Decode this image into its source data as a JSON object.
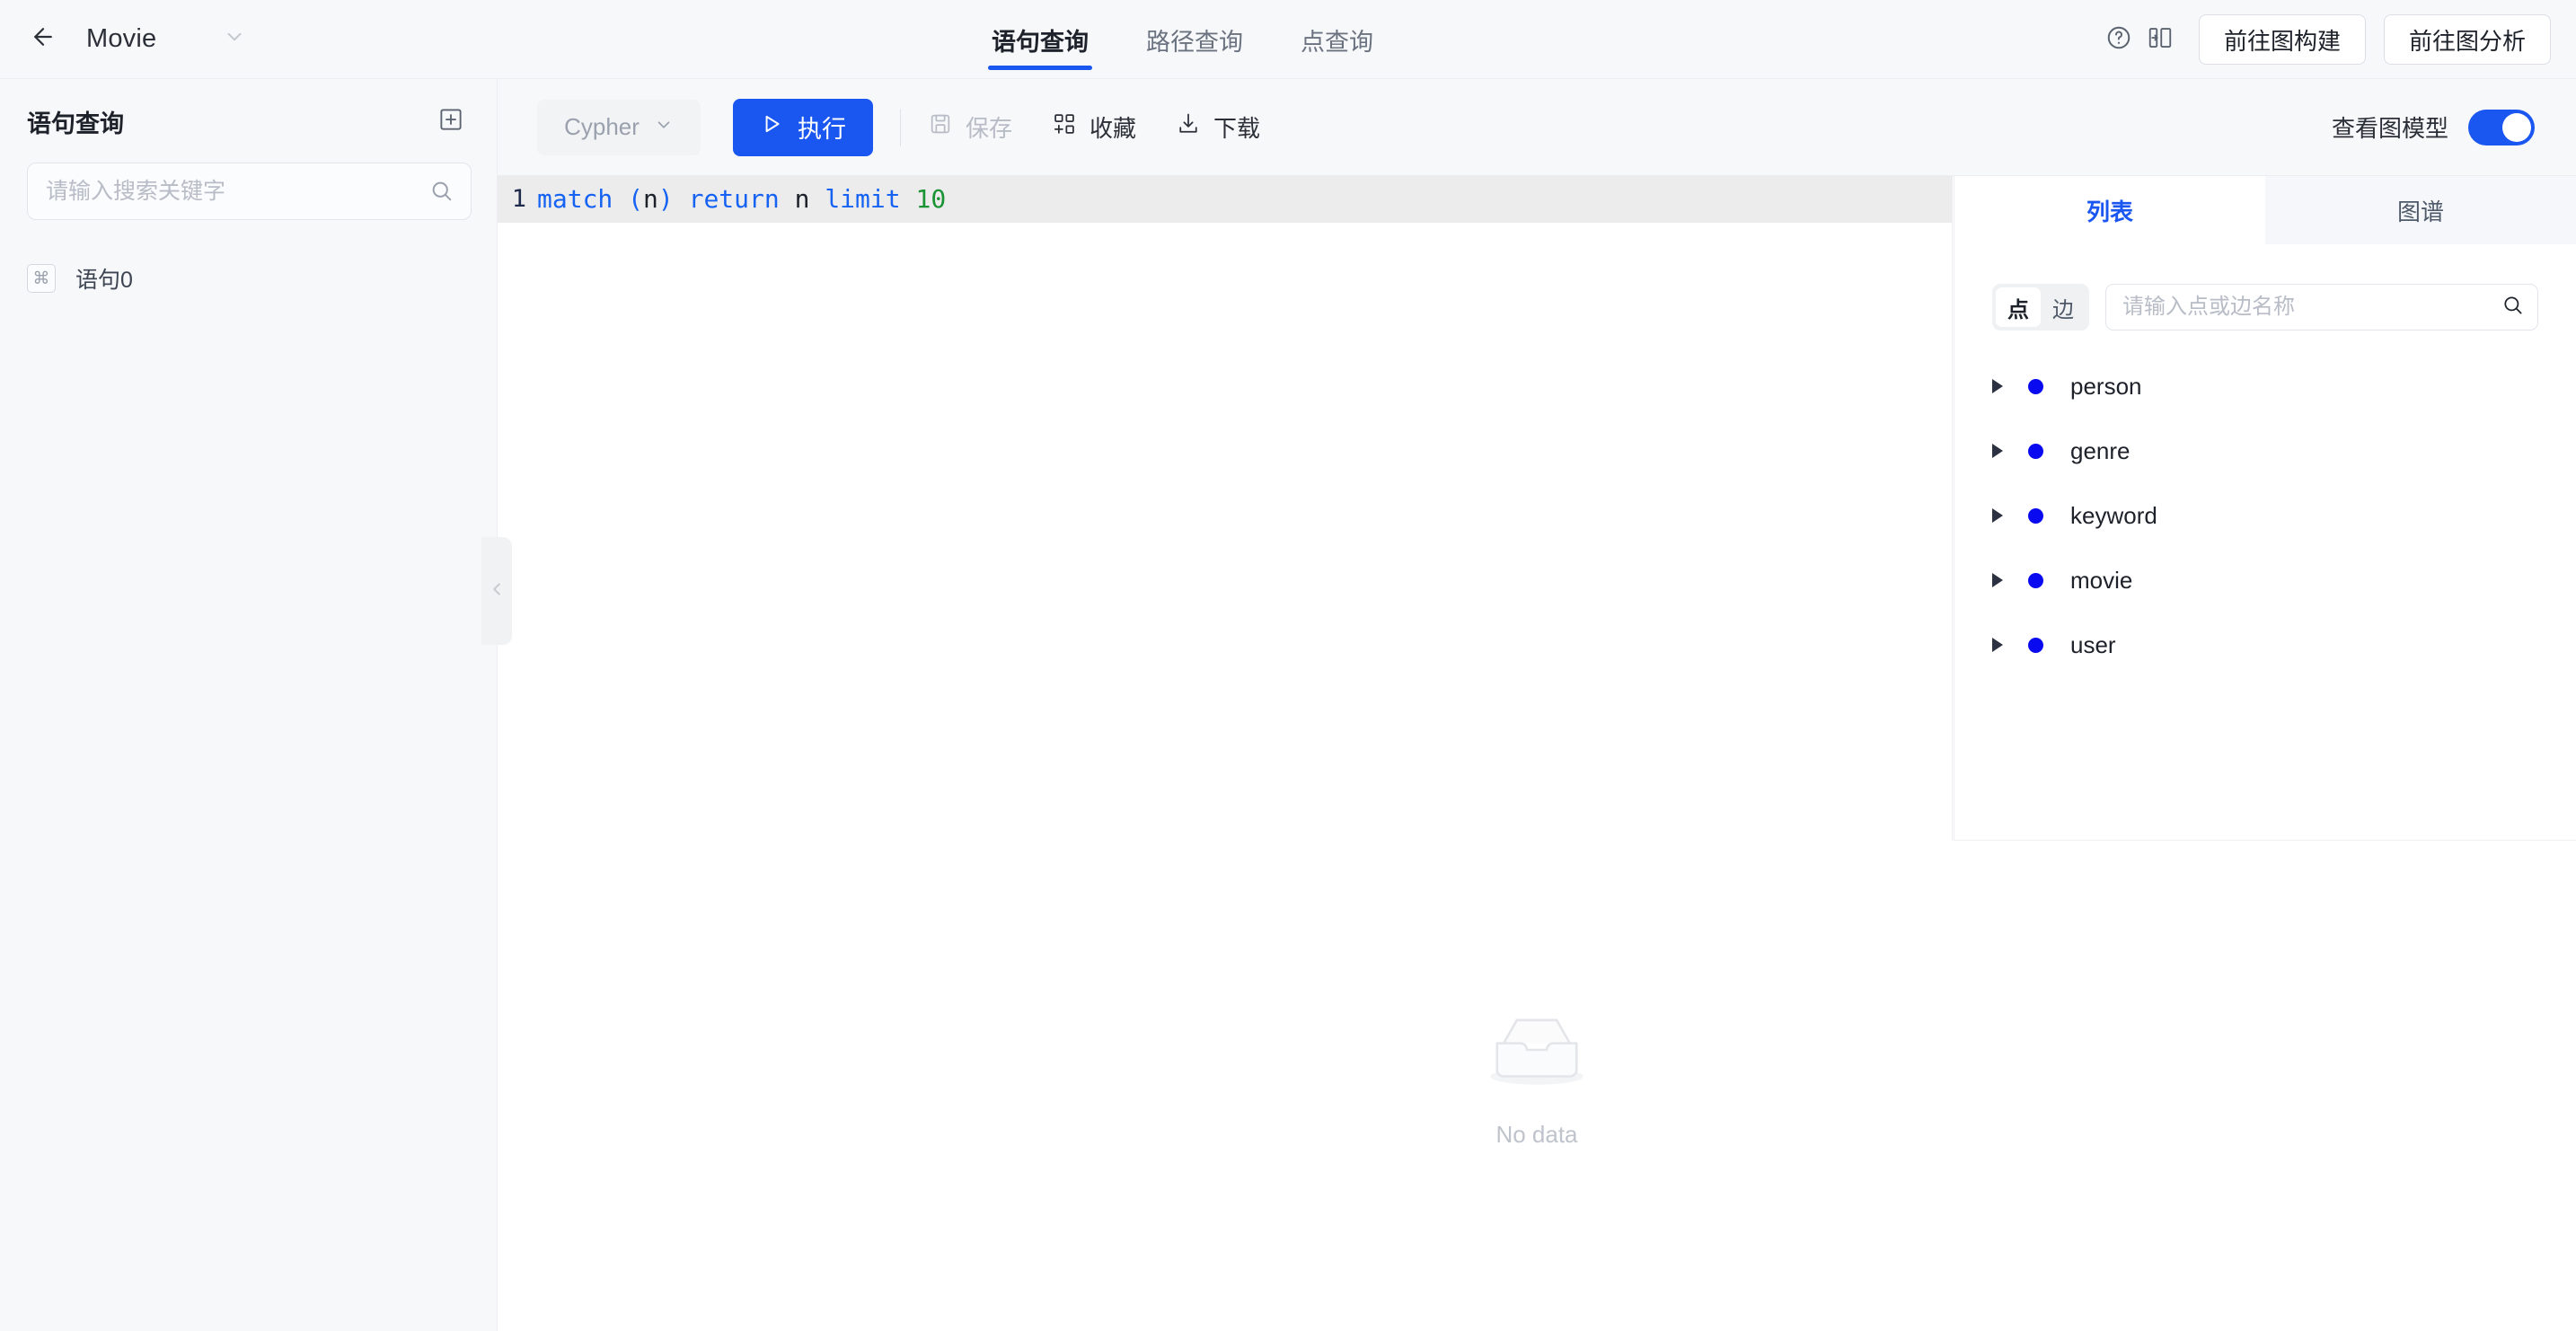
{
  "header": {
    "back_icon": "arrow-left-icon",
    "database_name": "Movie",
    "caret_icon": "chevron-down-icon",
    "tabs": [
      {
        "label": "语句查询",
        "active": true
      },
      {
        "label": "路径查询",
        "active": false
      },
      {
        "label": "点查询",
        "active": false
      }
    ],
    "help_icon": "question-circle-icon",
    "layout_icon": "panel-layout-icon",
    "buttons": [
      {
        "label": "前往图构建"
      },
      {
        "label": "前往图分析"
      }
    ]
  },
  "sidebar": {
    "title": "语句查询",
    "add_icon": "plus-square-icon",
    "search": {
      "placeholder": "请输入搜索关键字",
      "value": "",
      "icon": "search-icon"
    },
    "items": [
      {
        "label": "语句0",
        "icon": "command-icon"
      }
    ],
    "collapse_icon": "chevron-left-icon"
  },
  "toolbar": {
    "language": "Cypher",
    "language_caret_icon": "chevron-down-icon",
    "run_label": "执行",
    "run_icon": "play-icon",
    "save_label": "保存",
    "save_icon": "save-disk-icon",
    "favorite_label": "收藏",
    "favorite_icon": "add-collection-icon",
    "download_label": "下载",
    "download_icon": "download-icon",
    "view_model_label": "查看图模型",
    "view_model_on": true
  },
  "editor": {
    "line_number": "1",
    "tokens": [
      {
        "text": "match",
        "type": "keyword"
      },
      {
        "text": " ",
        "type": "space"
      },
      {
        "text": "(",
        "type": "keyword"
      },
      {
        "text": "n",
        "type": "plain"
      },
      {
        "text": ")",
        "type": "keyword"
      },
      {
        "text": " ",
        "type": "space"
      },
      {
        "text": "return",
        "type": "keyword"
      },
      {
        "text": " ",
        "type": "space"
      },
      {
        "text": "n",
        "type": "plain"
      },
      {
        "text": " ",
        "type": "space"
      },
      {
        "text": "limit",
        "type": "keyword"
      },
      {
        "text": " ",
        "type": "space"
      },
      {
        "text": "10",
        "type": "number"
      }
    ],
    "full_text": "match (n) return n limit 10"
  },
  "results": {
    "empty_icon": "empty-box-icon",
    "empty_text": "No data"
  },
  "right_panel": {
    "tabs": [
      {
        "label": "列表",
        "active": true
      },
      {
        "label": "图谱",
        "active": false
      }
    ],
    "segment": [
      {
        "label": "点",
        "selected": true
      },
      {
        "label": "边",
        "selected": false
      }
    ],
    "search": {
      "placeholder": "请输入点或边名称",
      "value": "",
      "icon": "search-icon"
    },
    "nodes": [
      {
        "label": "person"
      },
      {
        "label": "genre"
      },
      {
        "label": "keyword"
      },
      {
        "label": "movie"
      },
      {
        "label": "user"
      }
    ]
  },
  "colors": {
    "accent": "#1a56f0",
    "node_dot": "#0a0af0",
    "header_bg": "#f7f8fa",
    "code_keyword": "#1663f3",
    "code_number": "#1a9334",
    "muted_text": "#b7bcc6"
  }
}
